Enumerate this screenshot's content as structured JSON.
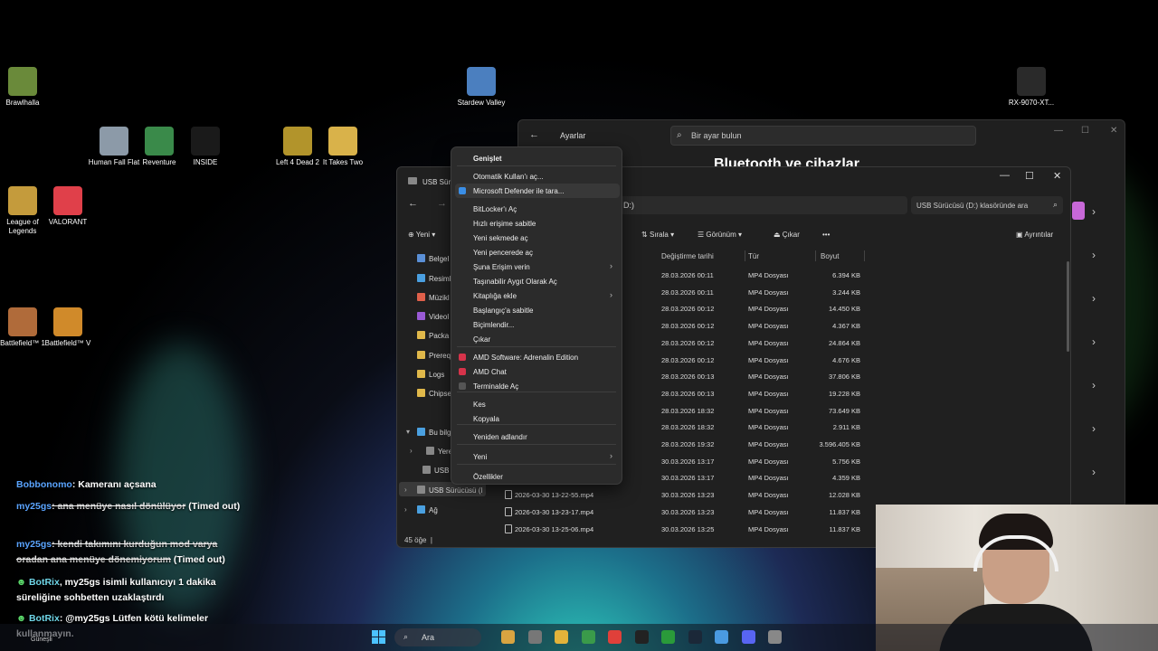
{
  "desktop": {
    "icons": [
      {
        "label": "Brawlhalla",
        "color": "#6a8a3a"
      },
      {
        "label": "Stardew Valley",
        "color": "#4b7fbf"
      },
      {
        "label": "RX-9070-XT...",
        "color": "#2a2a2a"
      },
      {
        "label": "Human Fall Flat",
        "color": "#8c9aa8"
      },
      {
        "label": "Reventure",
        "color": "#3a8a4a"
      },
      {
        "label": "INSIDE",
        "color": "#1a1a1a"
      },
      {
        "label": "Left 4 Dead 2",
        "color": "#b2942b"
      },
      {
        "label": "It Takes Two",
        "color": "#d9b24a"
      },
      {
        "label": "League of Legends",
        "color": "#c49b3c"
      },
      {
        "label": "VALORANT",
        "color": "#e0404a"
      },
      {
        "label": "Battlefield™ 1",
        "color": "#b06b3a"
      },
      {
        "label": "Battlefield™ V",
        "color": "#d08a2a"
      }
    ]
  },
  "settings": {
    "title": "Ayarlar",
    "search_placeholder": "Bir ayar bulun",
    "heading": "Bluetooth ve cihazlar"
  },
  "explorer": {
    "title": "USB Sürü",
    "address_tail": "D:)",
    "search_placeholder": "USB Sürücüsü (D:) klasöründe ara",
    "toolbar": {
      "new": "Yeni",
      "sort": "Sırala",
      "view": "Görünüm",
      "eject": "Çıkar",
      "more": "•••",
      "details": "Ayrıntılar"
    },
    "sidebar": [
      {
        "label": "Belgel",
        "color": "#5a8fd6"
      },
      {
        "label": "Resiml",
        "color": "#4a9fe0"
      },
      {
        "label": "Müzikl",
        "color": "#e0604a"
      },
      {
        "label": "Videol",
        "color": "#9a5ad6"
      },
      {
        "label": "Packa",
        "color": "#e0b84a"
      },
      {
        "label": "Prereq",
        "color": "#e0b84a"
      },
      {
        "label": "Logs",
        "color": "#e0b84a"
      },
      {
        "label": "Chipse",
        "color": "#e0b84a"
      },
      {
        "label": "Bu bilg",
        "color": "#4aa0e0"
      },
      {
        "label": "Yerel",
        "color": "#888888"
      },
      {
        "label": "USB S",
        "color": "#888888"
      },
      {
        "label": "USB Sürücüsü (I",
        "color": "#888888"
      },
      {
        "label": "Ağ",
        "color": "#4aa0e0"
      }
    ],
    "columns": {
      "modified": "Değiştirme tarihi",
      "type": "Tür",
      "size": "Boyut"
    },
    "rows": [
      {
        "name": "",
        "date": "28.03.2026 00:11",
        "type": "MP4 Dosyası",
        "size": "6.394 KB"
      },
      {
        "name": "",
        "date": "28.03.2026 00:11",
        "type": "MP4 Dosyası",
        "size": "3.244 KB"
      },
      {
        "name": "",
        "date": "28.03.2026 00:12",
        "type": "MP4 Dosyası",
        "size": "14.450 KB"
      },
      {
        "name": "",
        "date": "28.03.2026 00:12",
        "type": "MP4 Dosyası",
        "size": "4.367 KB"
      },
      {
        "name": "",
        "date": "28.03.2026 00:12",
        "type": "MP4 Dosyası",
        "size": "24.864 KB"
      },
      {
        "name": "",
        "date": "28.03.2026 00:12",
        "type": "MP4 Dosyası",
        "size": "4.676 KB"
      },
      {
        "name": "",
        "date": "28.03.2026 00:13",
        "type": "MP4 Dosyası",
        "size": "37.806 KB"
      },
      {
        "name": "",
        "date": "28.03.2026 00:13",
        "type": "MP4 Dosyası",
        "size": "19.228 KB"
      },
      {
        "name": "",
        "date": "28.03.2026 18:32",
        "type": "MP4 Dosyası",
        "size": "73.649 KB"
      },
      {
        "name": "",
        "date": "28.03.2026 18:32",
        "type": "MP4 Dosyası",
        "size": "2.911 KB"
      },
      {
        "name": "",
        "date": "28.03.2026 19:32",
        "type": "MP4 Dosyası",
        "size": "3.596.405 KB"
      },
      {
        "name": "",
        "date": "30.03.2026 13:17",
        "type": "MP4 Dosyası",
        "size": "5.756 KB"
      },
      {
        "name": "",
        "date": "30.03.2026 13:17",
        "type": "MP4 Dosyası",
        "size": "4.359 KB"
      },
      {
        "name": "2026-03-30 13-22-55.mp4",
        "date": "30.03.2026 13:23",
        "type": "MP4 Dosyası",
        "size": "12.028 KB"
      },
      {
        "name": "2026-03-30 13-23-17.mp4",
        "date": "30.03.2026 13:23",
        "type": "MP4 Dosyası",
        "size": "11.837 KB"
      },
      {
        "name": "2026-03-30 13-25-06.mp4",
        "date": "30.03.2026 13:25",
        "type": "MP4 Dosyası",
        "size": "11.837 KB"
      }
    ],
    "status": "45 öğe"
  },
  "context_menu": {
    "items": [
      {
        "label": "Genişlet",
        "bold": true
      },
      {
        "label": "Otomatik Kullan'ı aç..."
      },
      {
        "label": "Microsoft Defender ile tara...",
        "icon_color": "#3a8ee6",
        "highlight": true
      },
      {
        "label": "BitLocker'ı Aç"
      },
      {
        "label": "Hızlı erişime sabitle"
      },
      {
        "label": "Yeni sekmede aç"
      },
      {
        "label": "Yeni pencerede aç"
      },
      {
        "label": "Şuna Erişim verin",
        "submenu": true
      },
      {
        "label": "Taşınabilir Aygıt Olarak Aç"
      },
      {
        "label": "Kitaplığa ekle",
        "submenu": true
      },
      {
        "label": "Başlangıç'a sabitle"
      },
      {
        "label": "Biçimlendir..."
      },
      {
        "label": "Çıkar"
      },
      {
        "label": "AMD Software: Adrenalin Edition",
        "icon_color": "#d6334a"
      },
      {
        "label": "AMD Chat",
        "icon_color": "#d6334a"
      },
      {
        "label": "Terminalde Aç",
        "icon_color": "#555555"
      },
      {
        "label": "Kes"
      },
      {
        "label": "Kopyala"
      },
      {
        "label": "Yeniden adlandır"
      },
      {
        "label": "Yeni",
        "submenu": true
      },
      {
        "label": "Özellikler"
      }
    ]
  },
  "chat": [
    {
      "user": "Bobbonomo",
      "text": ": Kameranı açsana"
    },
    {
      "user": "my25gs",
      "text": ": ana menüye nasıl dönülüyor",
      "suffix": " (Timed out)"
    },
    {
      "user": "my25gs",
      "text": ": kendi takımını kurduğun mod varya oradan ana menüye dönemiyorum",
      "suffix": " (Timed out)"
    },
    {
      "user": "BotRix",
      "text": ", my25gs isimli kullanıcıyı 1 dakika süreliğine sohbetten uzaklaştırdı"
    },
    {
      "user": "BotRix",
      "text": ": @my25gs Lütfen kötü kelimeler kullanmayın."
    }
  ],
  "taskbar": {
    "search": "Ara",
    "weather": "Güneşli",
    "apps": [
      "#d9a441",
      "#777777",
      "#e3b33a",
      "#3a9a4a",
      "#e0403a",
      "#222222",
      "#2a9a3a",
      "#1b2838",
      "#4a9ae0",
      "#5865f2",
      "#888888"
    ]
  }
}
